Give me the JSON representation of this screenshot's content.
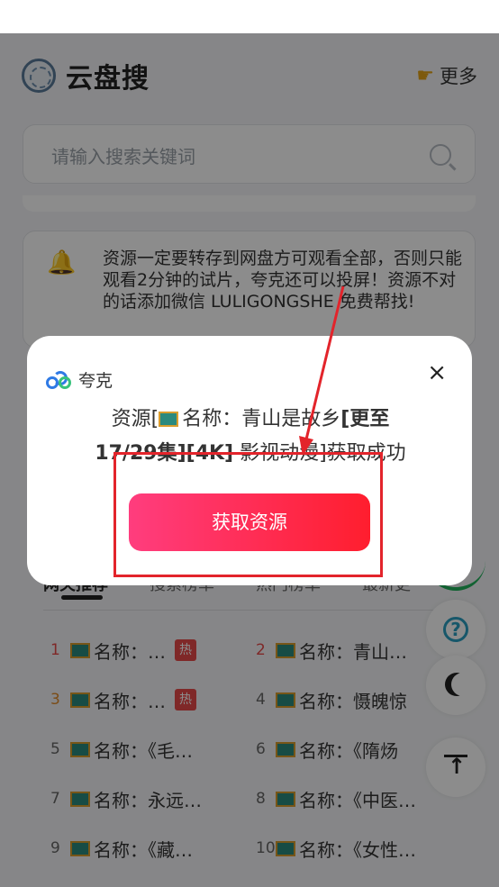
{
  "header": {
    "site_title": "云盘搜",
    "more_label": "更多"
  },
  "search": {
    "placeholder": "请输入搜索关键词"
  },
  "notice": {
    "text": "资源一定要转存到网盘方可观看全部，否则只能观看2分钟的试片，夸克还可以投屏！资源不对的话添加微信 LULIGONGSHE 免费帮找!"
  },
  "tabs": [
    {
      "label": "网关推荐"
    },
    {
      "label": "搜索榜单"
    },
    {
      "label": "热门榜单"
    },
    {
      "label": "最新更"
    }
  ],
  "list": [
    {
      "rank": "1",
      "name": "名称：…",
      "hot": "热",
      "rank_color": "#e84a4a"
    },
    {
      "rank": "2",
      "name": "名称：青山…",
      "hot": "",
      "rank_color": "#e84a4a"
    },
    {
      "rank": "3",
      "name": "名称：…",
      "hot": "热",
      "rank_color": "#e08a2a"
    },
    {
      "rank": "4",
      "name": "名称：慑魄惊",
      "hot": "",
      "rank_color": "#666666"
    },
    {
      "rank": "5",
      "name": "名称：《毛…",
      "hot": "",
      "rank_color": "#666666"
    },
    {
      "rank": "6",
      "name": "名称：《隋炀",
      "hot": "",
      "rank_color": "#666666"
    },
    {
      "rank": "7",
      "name": "名称：永远…",
      "hot": "",
      "rank_color": "#666666"
    },
    {
      "rank": "8",
      "name": "名称：《中医…",
      "hot": "",
      "rank_color": "#666666"
    },
    {
      "rank": "9",
      "name": "名称：《藏…",
      "hot": "",
      "rank_color": "#666666"
    },
    {
      "rank": "10",
      "name": "名称：《女性…",
      "hot": "",
      "rank_color": "#666666"
    }
  ],
  "floating": {
    "help": "?"
  },
  "modal": {
    "brand": "夸克",
    "close": "×",
    "line1_prefix": "资源[",
    "line1_main": "名称：青山是故乡",
    "line1_bold": "[更至",
    "line2_bold": "17/29集][4K]",
    "line2_rest": " 影视动漫]获取成功",
    "button_label": "获取资源"
  },
  "colors": {
    "accent": "#ff2a50",
    "annotation_red": "#e3242b"
  }
}
